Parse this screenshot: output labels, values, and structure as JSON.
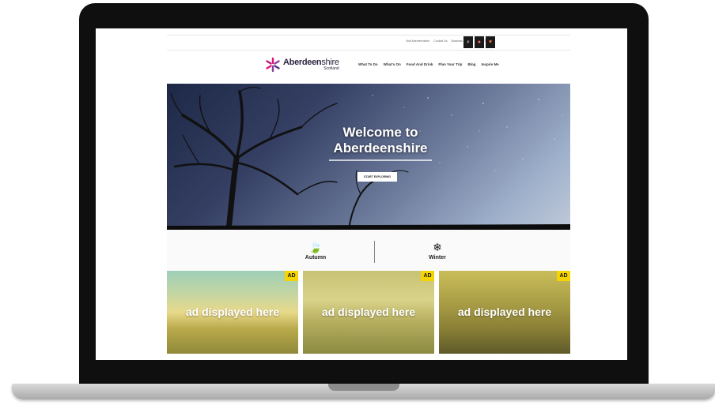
{
  "utility_bar": {
    "links": [
      "Visit Aberdeenshire",
      "Contact Us",
      "Business Events",
      "Travel Trade"
    ],
    "icons": [
      "search-icon",
      "location-icon",
      "heart-icon"
    ]
  },
  "logo": {
    "name_bold": "Aberdeen",
    "name_thin": "shire",
    "subtitle": "Scotland"
  },
  "nav": [
    "What To Do",
    "What's On",
    "Food And Drink",
    "Plan Your Trip",
    "Blog",
    "Inspire Me"
  ],
  "hero": {
    "title": "Welcome to Aberdeenshire",
    "button": "START EXPLORING"
  },
  "seasons": [
    {
      "label": "Autumn",
      "icon": "leaf-icon",
      "glyph": "🍃"
    },
    {
      "label": "Winter",
      "icon": "snowflake-icon",
      "glyph": "❄"
    }
  ],
  "ads": [
    {
      "badge": "AD",
      "text": "ad displayed here",
      "theme": "beach"
    },
    {
      "badge": "AD",
      "text": "ad displayed here",
      "theme": "cattle"
    },
    {
      "badge": "AD",
      "text": "ad displayed here",
      "theme": "interior"
    }
  ],
  "colors": {
    "ad_badge": "#f5d400",
    "brand": "#2d2540",
    "accent": "#e0157a",
    "hero_sky": "#3a466a"
  }
}
